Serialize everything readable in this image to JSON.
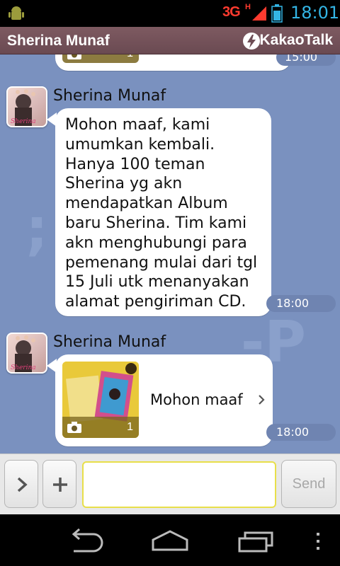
{
  "status_bar": {
    "network": "3G",
    "network_sub": "H",
    "time": "18:01"
  },
  "header": {
    "title": "Sherina Munaf",
    "app_name": "KakaoTalk"
  },
  "chat": {
    "watermarks": [
      ";",
      "-P"
    ],
    "previous_message": {
      "photo_count": "1",
      "time": "15:00"
    },
    "messages": [
      {
        "sender": "Sherina Munaf",
        "text": "Mohon maaf, kami\numumkan kembali.\nHanya 100 teman\nSherina yg akn\nmendapatkan Album\nbaru Sherina. Tim kami\nakn menghubungi para\npemenang mulai dari tgl\n15 Juli utk menanyakan\nalamat pengiriman CD.",
        "time": "18:00"
      },
      {
        "sender": "Sherina Munaf",
        "link_title": "Mohon maaf",
        "photo_count": "1",
        "time": "18:00"
      }
    ]
  },
  "input_bar": {
    "value": "",
    "send_label": "Send"
  },
  "colors": {
    "chat_bg": "#7a91bf",
    "title_bar": "#765259",
    "input_border": "#e8df4a",
    "time_pill": "#6f84b1"
  }
}
